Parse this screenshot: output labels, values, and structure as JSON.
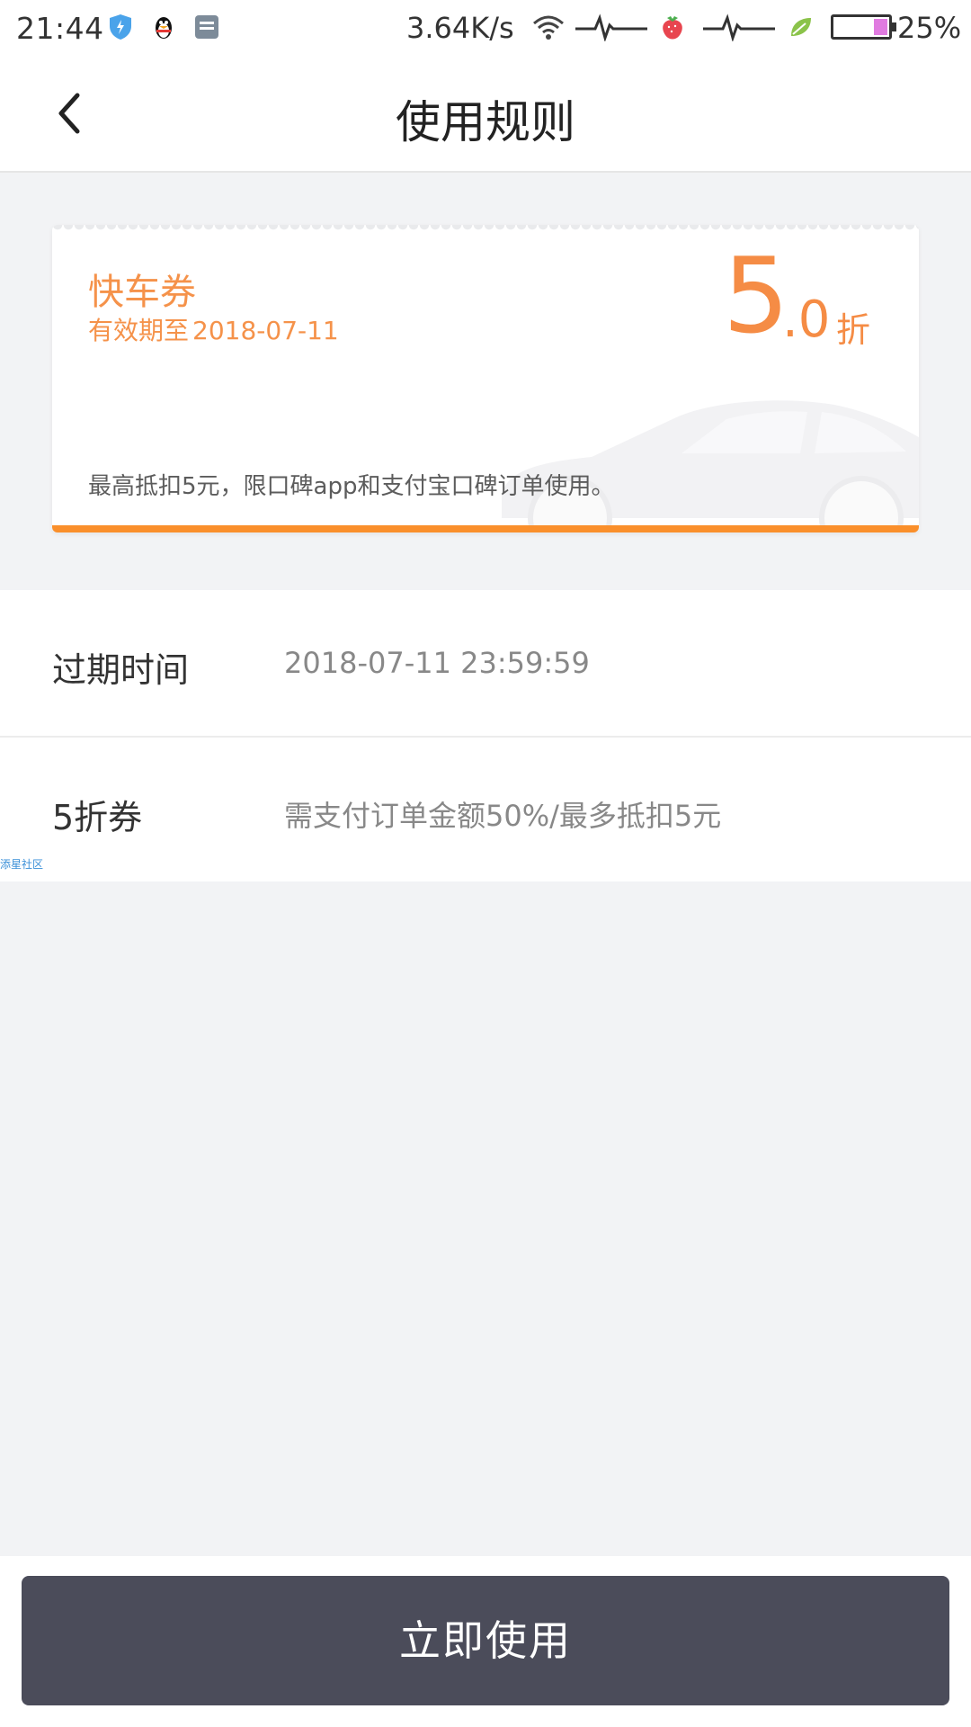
{
  "status_bar": {
    "time": "21:44",
    "net_speed": "3.64K/s",
    "battery_percent": "25%",
    "battery_level": 0.25,
    "icons": [
      "shield-icon",
      "qq-penguin-icon",
      "notes-icon",
      "wifi-icon",
      "activity-icon",
      "strawberry-icon",
      "activity-icon",
      "leaf-icon",
      "battery-icon"
    ]
  },
  "header": {
    "title": "使用规则",
    "back_icon": "chevron-left-icon"
  },
  "coupon": {
    "name": "快车券",
    "validity_label": "有效期至",
    "validity_date": "2018-07-11",
    "discount_big": "5",
    "discount_decimal": ".0",
    "discount_unit": "折",
    "note": "最高抵扣5元，限口碑app和支付宝口碑订单使用。",
    "accent_color": "#f58c45",
    "bar_color": "#fa8f2b"
  },
  "rows": [
    {
      "label": "过期时间",
      "value": "2018-07-11 23:59:59"
    },
    {
      "label": "5折券",
      "value": "需支付订单金额50%/最多抵扣5元"
    }
  ],
  "watermark": "添星社区",
  "footer": {
    "use_button_label": "立即使用",
    "button_color": "#4b4c5a"
  }
}
